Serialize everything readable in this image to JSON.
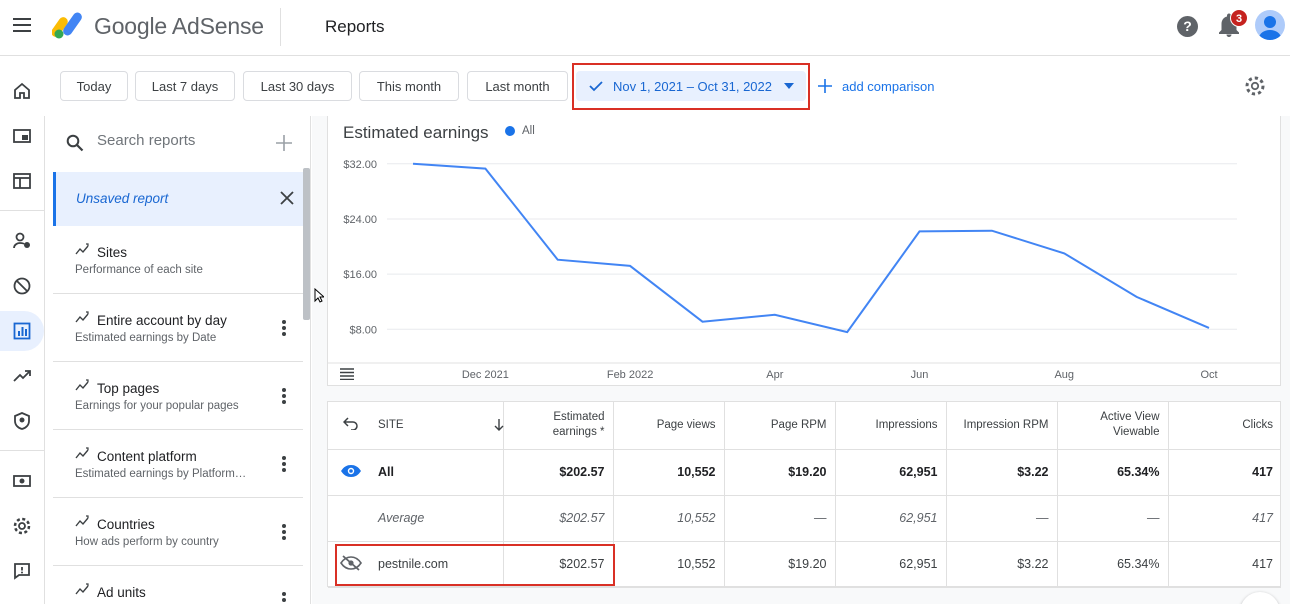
{
  "header": {
    "brand": "Google AdSense",
    "page_title": "Reports",
    "notification_count": "3"
  },
  "rail_icons": [
    "home-icon",
    "ads-icon",
    "sites-icon",
    "account-icon",
    "blocking-icon",
    "reports-icon",
    "optimization-icon",
    "privacy-icon",
    "payments-icon",
    "settings-icon",
    "feedback-icon"
  ],
  "date_filters": {
    "chips": [
      "Today",
      "Last 7 days",
      "Last 30 days",
      "This month",
      "Last month"
    ],
    "selected_range": "Nov 1, 2021 – Oct 31, 2022",
    "add_comparison": "add comparison"
  },
  "reports_panel": {
    "search_placeholder": "Search reports",
    "unsaved_report": "Unsaved report",
    "items": [
      {
        "title": "Sites",
        "subtitle": "Performance of each site"
      },
      {
        "title": "Entire account by day",
        "subtitle": "Estimated earnings by Date"
      },
      {
        "title": "Top pages",
        "subtitle": "Earnings for your popular pages"
      },
      {
        "title": "Content platform",
        "subtitle": "Estimated earnings by Platform…"
      },
      {
        "title": "Countries",
        "subtitle": "How ads perform by country"
      },
      {
        "title": "Ad units",
        "subtitle": ""
      }
    ]
  },
  "chart_data": {
    "type": "line",
    "title": "Estimated earnings",
    "series": [
      {
        "name": "All",
        "values": [
          32.0,
          31.3,
          18.1,
          17.2,
          9.1,
          10.1,
          7.6,
          22.2,
          22.3,
          19.0,
          12.7,
          8.2
        ]
      }
    ],
    "x": [
      "Nov 2021",
      "Dec 2021",
      "Jan 2022",
      "Feb 2022",
      "Mar 2022",
      "Apr 2022",
      "May 2022",
      "Jun 2022",
      "Jul 2022",
      "Aug 2022",
      "Sep 2022",
      "Oct 2022"
    ],
    "x_tick_labels": [
      "Dec 2021",
      "Feb 2022",
      "Apr",
      "Jun",
      "Aug",
      "Oct"
    ],
    "x_tick_index": [
      1,
      3,
      5,
      7,
      9,
      11
    ],
    "y_ticks": [
      8,
      16,
      24,
      32
    ],
    "y_tick_labels": [
      "$8.00",
      "$16.00",
      "$24.00",
      "$32.00"
    ],
    "ylim": [
      5,
      34
    ],
    "color": "#4285f4",
    "grid": true
  },
  "table": {
    "headers": [
      "SITE",
      "Estimated earnings *",
      "Page views",
      "Page RPM",
      "Impressions",
      "Impression RPM",
      "Active View Viewable",
      "Clicks"
    ],
    "rows": [
      {
        "type": "total",
        "cells": [
          "All",
          "$202.57",
          "10,552",
          "$19.20",
          "62,951",
          "$3.22",
          "65.34%",
          "417"
        ]
      },
      {
        "type": "avg",
        "cells": [
          "Average",
          "$202.57",
          "10,552",
          "—",
          "62,951",
          "—",
          "—",
          "417"
        ]
      },
      {
        "type": "site",
        "cells": [
          "pestnile.com",
          "$202.57",
          "10,552",
          "$19.20",
          "62,951",
          "$3.22",
          "65.34%",
          "417"
        ]
      }
    ]
  },
  "colors": {
    "accent": "#1a73e8",
    "highlight": "#d93025"
  }
}
